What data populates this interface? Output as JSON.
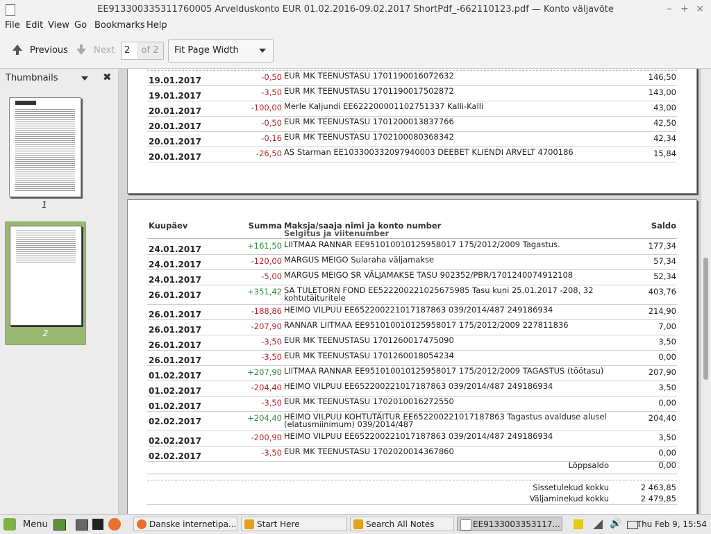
{
  "window": {
    "title": "EE913300335311760005 Arvelduskonto EUR 01.02.2016-09.02.2017 ShortPdf_-662110123.pdf — Konto väljavõte"
  },
  "menu": [
    "File",
    "Edit",
    "View",
    "Go",
    "Bookmarks",
    "Help"
  ],
  "toolbar": {
    "previous": "Previous",
    "next": "Next",
    "page_value": "2",
    "page_of": "of 2",
    "zoom": "Fit Page Width"
  },
  "sidebar": {
    "title": "Thumbnails",
    "thumbs": [
      "1",
      "2"
    ]
  },
  "page1_rows": [
    {
      "date": "19.01.2017",
      "amount": "-0,50",
      "desc": "EUR MK TEENUSTASU 1701190016072632",
      "balance": "146,50"
    },
    {
      "date": "19.01.2017",
      "amount": "-3,50",
      "desc": "EUR MK TEENUSTASU 1701190017502872",
      "balance": "143,00"
    },
    {
      "date": "20.01.2017",
      "amount": "-100,00",
      "desc": "Merle Kaljundi EE622200001102751337 Kalli-Kalli",
      "balance": "43,00"
    },
    {
      "date": "20.01.2017",
      "amount": "-0,50",
      "desc": "EUR MK TEENUSTASU 1701200013837766",
      "balance": "42,50"
    },
    {
      "date": "20.01.2017",
      "amount": "-0,16",
      "desc": "EUR MK TEENUSTASU 1702100080368342",
      "balance": "42,34"
    },
    {
      "date": "20.01.2017",
      "amount": "-26,50",
      "desc": "AS Starman EE103300332097940003 DEEBET KLIENDI ARVELT 4700186",
      "balance": "15,84"
    }
  ],
  "table_header": {
    "date": "Kuupäev",
    "amount": "Summa",
    "payer": "Maksja/saaja nimi ja konto number",
    "payer_sub": "Selgitus ja viitenumber",
    "balance": "Saldo"
  },
  "page2_rows": [
    {
      "date": "24.01.2017",
      "amount": "+161,50",
      "desc": "LIITMAA RANNAR EE951010010125958017 175/2012/2009 Tagastus.",
      "balance": "177,34"
    },
    {
      "date": "24.01.2017",
      "amount": "-120,00",
      "desc": "MARGUS MEIGO Sularaha väljamakse",
      "balance": "57,34"
    },
    {
      "date": "24.01.2017",
      "amount": "-5,00",
      "desc": "MARGUS MEIGO SR VÄLJAMAKSE TASU 902352/PBR/1701240074912108",
      "balance": "52,34"
    },
    {
      "date": "26.01.2017",
      "amount": "+351,42",
      "desc": "SA TULETORN FOND EE522200221025675985 Tasu kuni 25.01.2017 -208, 32 kohtutäituritele",
      "balance": "403,76"
    },
    {
      "date": "26.01.2017",
      "amount": "-188,86",
      "desc": "HEIMO VILPUU EE652200221017187863 039/2014/487 249186934",
      "balance": "214,90"
    },
    {
      "date": "26.01.2017",
      "amount": "-207,90",
      "desc": "RANNAR LIITMAA EE951010010125958017 175/2012/2009 227811836",
      "balance": "7,00"
    },
    {
      "date": "26.01.2017",
      "amount": "-3,50",
      "desc": "EUR MK TEENUSTASU 1701260017475090",
      "balance": "3,50"
    },
    {
      "date": "26.01.2017",
      "amount": "-3,50",
      "desc": "EUR MK TEENUSTASU 1701260018054234",
      "balance": "0,00"
    },
    {
      "date": "01.02.2017",
      "amount": "+207,90",
      "desc": "LIITMAA RANNAR EE951010010125958017 175/2012/2009 TAGASTUS (töötasu)",
      "balance": "207,90"
    },
    {
      "date": "01.02.2017",
      "amount": "-204,40",
      "desc": "HEIMO VILPUU EE652200221017187863 039/2014/487 249186934",
      "balance": "3,50"
    },
    {
      "date": "01.02.2017",
      "amount": "-3,50",
      "desc": "EUR MK TEENUSTASU 1702010016272550",
      "balance": "0,00"
    },
    {
      "date": "02.02.2017",
      "amount": "+204,40",
      "desc": "HEIMO VILPUU KOHTUTÄITUR EE652200221017187863 Tagastus avalduse alusel (elatusmiinimum) 039/2014/487",
      "balance": "204,40"
    },
    {
      "date": "02.02.2017",
      "amount": "-200,90",
      "desc": "HEIMO VILPUU EE652200221017187863 039/2014/487 249186934",
      "balance": "3,50"
    },
    {
      "date": "02.02.2017",
      "amount": "-3,50",
      "desc": "EUR MK TEENUSTASU 1702020014367860",
      "balance": "0,00"
    }
  ],
  "summary": {
    "closing_label": "Lõppsaldo",
    "closing_value": "0,00",
    "in_label": "Sissetulekud kokku",
    "in_value": "2 463,85",
    "out_label": "Väljaminekud kokku",
    "out_value": "2 479,85"
  },
  "taskbar": {
    "menu_label": "Menu",
    "windows": [
      "Danske internetipa...",
      "Start Here",
      "Search All Notes",
      "EE9133003353117..."
    ],
    "clock": "Thu Feb 9, 15:54"
  }
}
